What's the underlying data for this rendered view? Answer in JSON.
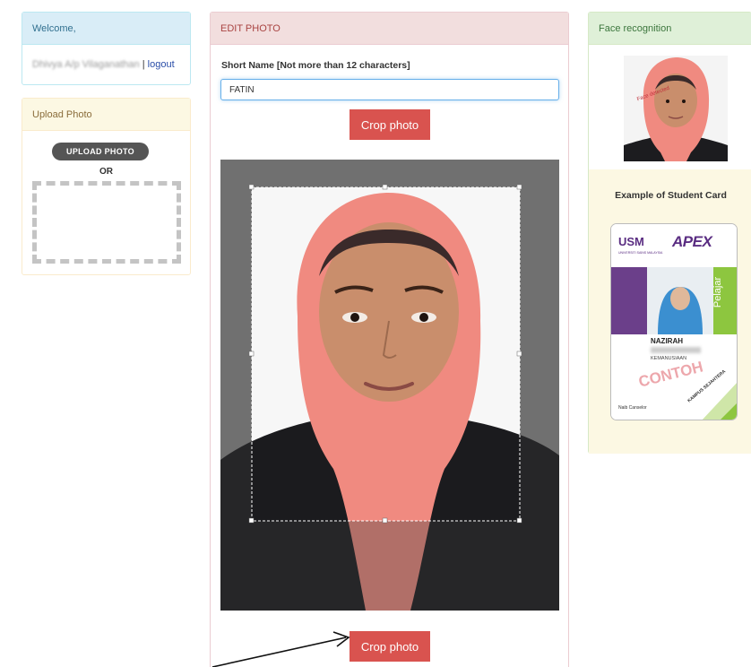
{
  "welcome": {
    "title": "Welcome,",
    "user_name": "Dhivya A/p Vilaganathan",
    "separator": " | ",
    "logout_label": "logout"
  },
  "upload": {
    "title": "Upload Photo",
    "button_label": "UPLOAD PHOTO",
    "or_label": "OR"
  },
  "edit": {
    "title": "EDIT PHOTO",
    "field_label": "Short Name [Not more than 12 characters]",
    "short_name_value": "FATIN",
    "crop_label_top": "Crop photo",
    "crop_label_bottom": "Crop photo"
  },
  "face": {
    "title": "Face recognition",
    "stamp_text": "Face detected",
    "example_title": "Example of Student Card",
    "card": {
      "usm_logo_text": "USM",
      "usm_sub": "UNIVERSITI SAINS MALAYSIA",
      "apex_text": "APEX",
      "role": "Pelajar",
      "student_name": "NAZIRAH",
      "faculty": "KEMANUSIAAN",
      "campus": "KAMPUS SEJAHTERA",
      "watermark": "CONTOH",
      "signatory": "Naib Canselor"
    }
  },
  "colors": {
    "crop_button": "#d9534f",
    "hijab": "#f08a80",
    "editor_bg": "#8c8c8c"
  }
}
